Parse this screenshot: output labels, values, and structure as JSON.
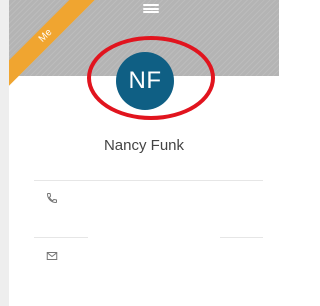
{
  "ribbon": {
    "label": "Me"
  },
  "contact": {
    "initials": "NF",
    "name": "Nancy Funk"
  },
  "colors": {
    "avatar": "#0f5f84",
    "ribbon": "#f0a530",
    "highlight": "#e1141e",
    "header": "#b4b4b4"
  },
  "icons": {
    "handle": "drag-handle-icon",
    "phone": "phone-icon",
    "email": "envelope-icon"
  }
}
